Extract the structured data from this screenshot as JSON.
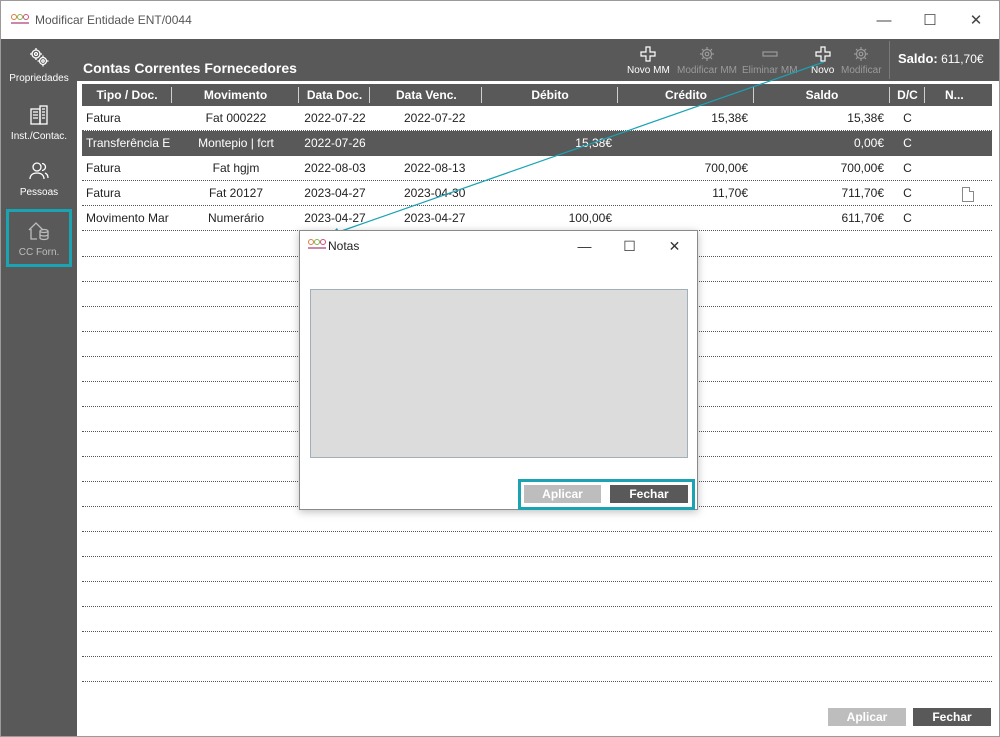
{
  "window": {
    "title": "Modificar Entidade ENT/0044"
  },
  "window_controls": {
    "minimize": "—",
    "maximize": "☐",
    "close": "✕"
  },
  "sidebar": {
    "items": [
      {
        "label": "Propriedades",
        "icon": "gears-icon"
      },
      {
        "label": "Inst./Contac.",
        "icon": "building-icon"
      },
      {
        "label": "Pessoas",
        "icon": "people-icon"
      },
      {
        "label": "CC Forn.",
        "icon": "home-coins-icon",
        "active": true
      }
    ]
  },
  "topbar": {
    "title": "Contas Correntes Fornecedores",
    "buttons": [
      {
        "label": "Novo MM",
        "icon": "plus-icon",
        "enabled": true
      },
      {
        "label": "Modificar MM",
        "icon": "gear-icon",
        "enabled": false
      },
      {
        "label": "Eliminar MM",
        "icon": "minus-icon",
        "enabled": false
      },
      {
        "label": "Novo",
        "icon": "plus-icon",
        "enabled": true
      },
      {
        "label": "Modificar",
        "icon": "gear-icon",
        "enabled": false
      }
    ],
    "saldo_label": "Saldo:",
    "saldo_value": "611,70€"
  },
  "grid": {
    "columns": [
      "Tipo / Doc.",
      "Movimento",
      "Data Doc.",
      "Data Venc.",
      "Débito",
      "Crédito",
      "Saldo",
      "D/C",
      "N..."
    ],
    "rows": [
      {
        "tipo": "Fatura",
        "movimento": "Fat 000222",
        "data_doc": "2022-07-22",
        "data_venc": "2022-07-22",
        "debito": "",
        "credito": "15,38€",
        "saldo": "15,38€",
        "dc": "C",
        "nota": false
      },
      {
        "tipo": "Transferência E",
        "movimento": "Montepio | fcrt",
        "data_doc": "2022-07-26",
        "data_venc": "",
        "debito": "15,38€",
        "credito": "",
        "saldo": "0,00€",
        "dc": "C",
        "nota": false,
        "selected": true
      },
      {
        "tipo": "Fatura",
        "movimento": "Fat hgjm",
        "data_doc": "2022-08-03",
        "data_venc": "2022-08-13",
        "debito": "",
        "credito": "700,00€",
        "saldo": "700,00€",
        "dc": "C",
        "nota": false
      },
      {
        "tipo": "Fatura",
        "movimento": "Fat 20127",
        "data_doc": "2023-04-27",
        "data_venc": "2023-04-30",
        "debito": "",
        "credito": "11,70€",
        "saldo": "711,70€",
        "dc": "C",
        "nota": true
      },
      {
        "tipo": "Movimento Mar",
        "movimento": "Numerário",
        "data_doc": "2023-04-27",
        "data_venc": "2023-04-27",
        "debito": "100,00€",
        "credito": "",
        "saldo": "611,70€",
        "dc": "C",
        "nota": false
      }
    ]
  },
  "footer": {
    "apply_label": "Aplicar",
    "close_label": "Fechar"
  },
  "dialog": {
    "title": "Notas",
    "text_value": "",
    "apply_label": "Aplicar",
    "close_label": "Fechar"
  },
  "colors": {
    "dark": "#595959",
    "accent": "#1aa3b3",
    "disabled": "#bdbdbd"
  }
}
